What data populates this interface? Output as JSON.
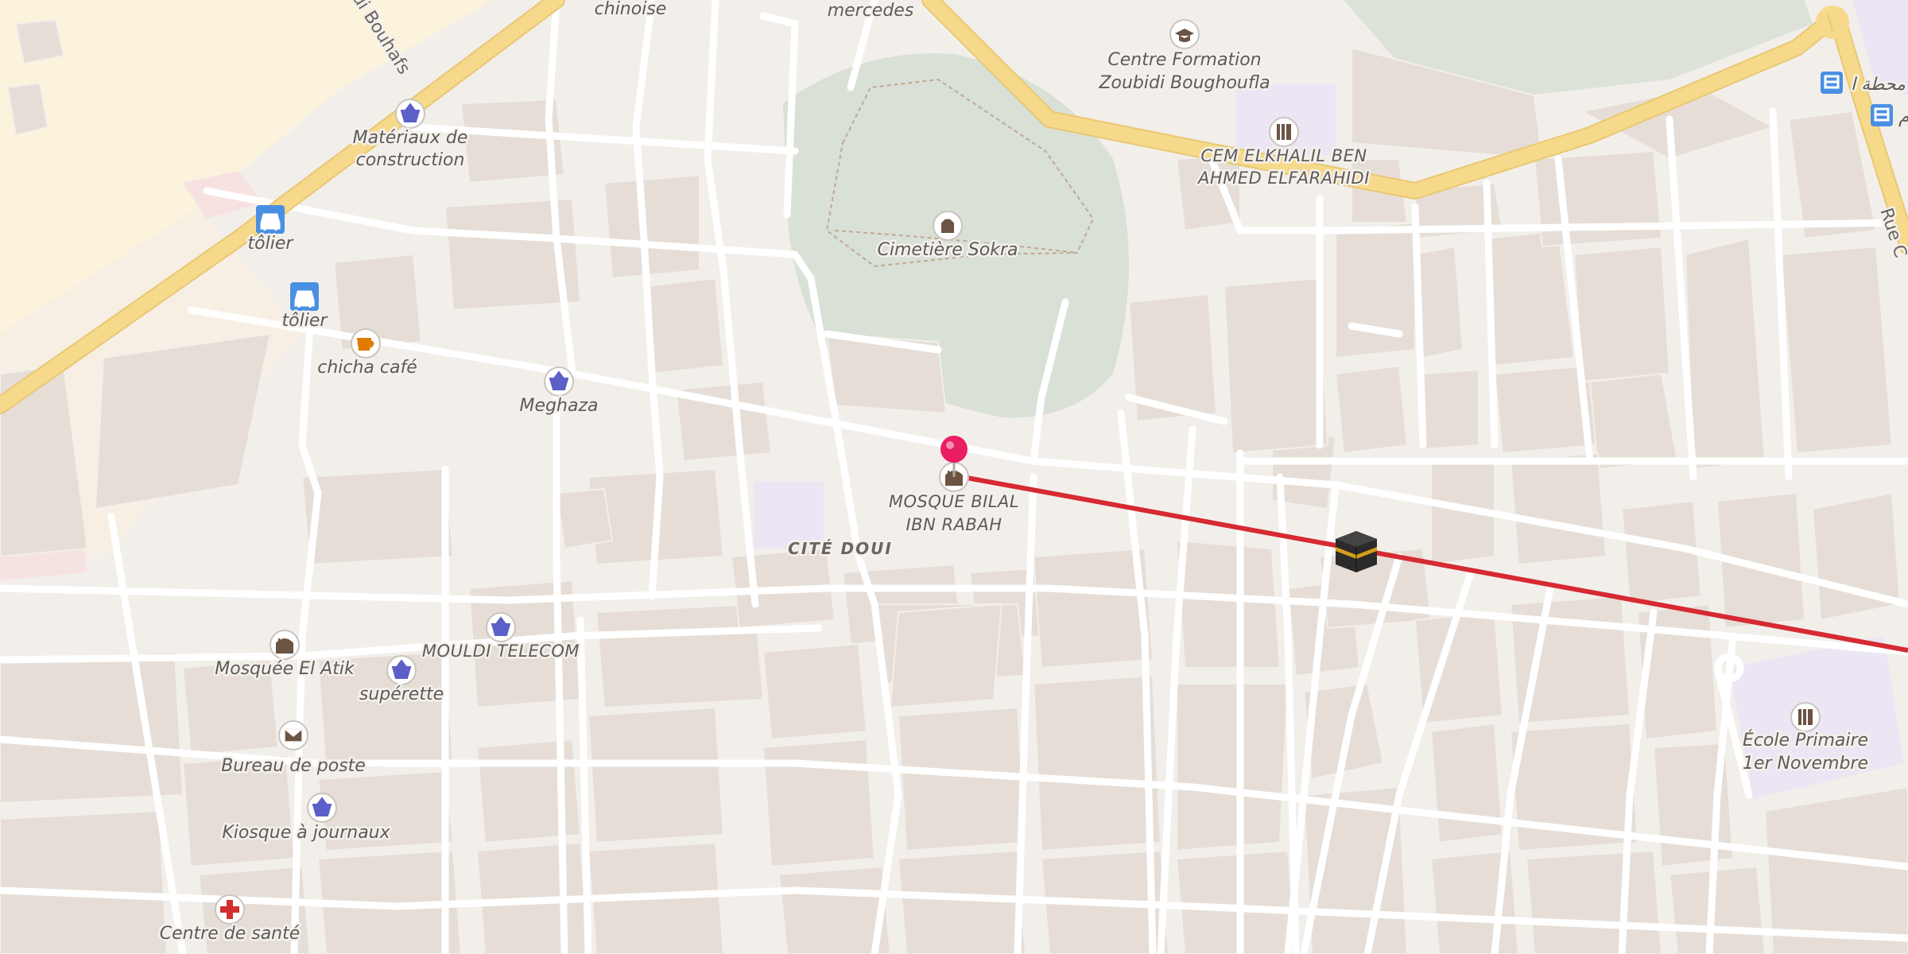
{
  "map": {
    "pois": [
      {
        "id": "chinoise",
        "label": "chinoise",
        "icon": "label-only"
      },
      {
        "id": "mercedes",
        "label": "mercedes",
        "icon": "label-only"
      },
      {
        "id": "centre-formation",
        "label_lines": [
          "Centre Formation",
          "Zoubidi Boughoufla"
        ],
        "icon": "graduation-cap-icon"
      },
      {
        "id": "materiaux",
        "label_lines": [
          "Matériaux de",
          "construction"
        ],
        "icon": "shopping-basket-icon"
      },
      {
        "id": "cem",
        "label_lines": [
          "CEM ELKHALIL BEN",
          "AHMED ELFARAHIDI"
        ],
        "icon": "school-icon"
      },
      {
        "id": "cimetiere",
        "label": "Cimetière Sokra",
        "icon": "cemetery-icon"
      },
      {
        "id": "tolier1",
        "label": "tôlier",
        "icon": "car-repair-icon"
      },
      {
        "id": "tolier2",
        "label": "tôlier",
        "icon": "car-repair-icon"
      },
      {
        "id": "chicha",
        "label": "chicha café",
        "icon": "cafe-cup-icon"
      },
      {
        "id": "meghaza",
        "label": "Meghaza",
        "icon": "shopping-basket-icon"
      },
      {
        "id": "mosque-bilal",
        "label_lines": [
          "MOSQUE BILAL",
          "IBN RABAH"
        ],
        "icon": "mosque-icon"
      },
      {
        "id": "cite-doui",
        "label": "CITÉ DOUI",
        "icon": "district-label"
      },
      {
        "id": "mosquee-atik",
        "label": "Mosquée El Atik",
        "icon": "mosque-icon"
      },
      {
        "id": "mouldi",
        "label": "MOULDI TELECOM",
        "icon": "shopping-basket-icon"
      },
      {
        "id": "superette",
        "label": "supérette",
        "icon": "shopping-basket-icon"
      },
      {
        "id": "bureau-poste",
        "label": "Bureau de poste",
        "icon": "envelope-icon"
      },
      {
        "id": "kiosque",
        "label": "Kiosque à journaux",
        "icon": "shopping-basket-icon"
      },
      {
        "id": "centre-sante",
        "label": "Centre de santé",
        "icon": "medical-cross-icon"
      },
      {
        "id": "ecole-primaire",
        "label_lines": [
          "École Primaire",
          "1er Novembre"
        ],
        "icon": "school-icon"
      },
      {
        "id": "kaaba",
        "label": "",
        "icon": "kaaba-icon"
      },
      {
        "id": "bus-stop-1",
        "label": "محطة ا",
        "icon": "bus-stop-icon"
      },
      {
        "id": "bus-stop-2",
        "label": "م",
        "icon": "bus-stop-icon"
      }
    ],
    "streets": {
      "bouhafs": "oui Bouhafs",
      "rue-edge": "Rue C"
    },
    "colors": {
      "background": "#f2efeb",
      "building": "#e6ded6",
      "road": "#ffffff",
      "major_road": "#f7d98b",
      "cemetery": "#d9e0d6",
      "school_area": "#ece6f4",
      "qibla_line": "#d62a33",
      "pin": "#e91e63"
    }
  }
}
